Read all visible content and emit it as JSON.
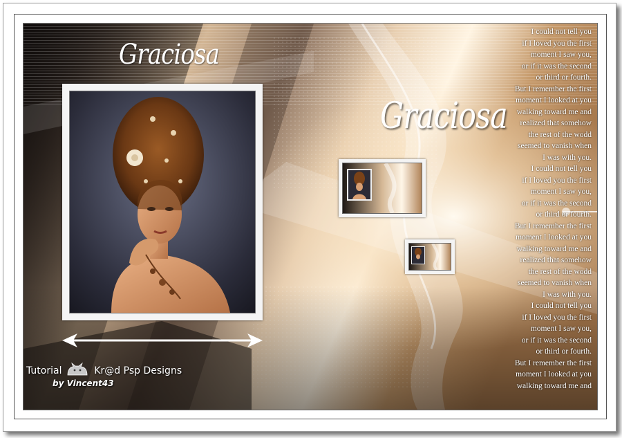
{
  "image": {
    "title_left": "Graciosa",
    "title_right": "Graciosa",
    "poem_lines": [
      "I could not tell you",
      "if I loved you the first",
      "moment I saw you,",
      "or if it was the second",
      "or third or fourth.",
      "But I remember the first",
      "moment I looked at you",
      "walking toward me and",
      "realized that somehow",
      "the rest of the wodd",
      "seemed to vanish when",
      "I was with you.",
      "I could not tell you",
      "if I loved you the first",
      "moment I saw you,",
      "or if it was the second",
      "or third or fourth.",
      "But I remember the first",
      "moment I looked at you",
      "walking toward me and",
      "realized that somehow",
      "the rest of the wodd",
      "seemed to vanish when",
      "I was with you.",
      "I could not tell you",
      "if I loved you the first",
      "moment I saw you,",
      "or if it was the second",
      "or third or fourth.",
      "But I remember the first",
      "moment I looked at you",
      "walking toward me and"
    ],
    "credit": {
      "prefix": "Tutorial",
      "brand": "Kr@d",
      "suffix": "Psp Designs",
      "byline": "by Vincent43"
    }
  },
  "icons": {
    "logo": "cat-logo-icon",
    "arrow": "double-arrow-icon"
  },
  "colors": {
    "warm_highlight": "#f3dcc0",
    "bronze": "#b98a5c",
    "dark_brown": "#2a221c",
    "frame": "#ffffff"
  }
}
